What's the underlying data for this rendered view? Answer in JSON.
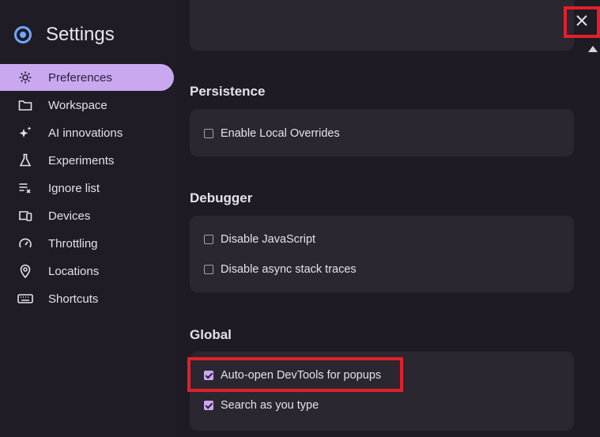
{
  "header": {
    "title": "Settings",
    "logo_icon": "settings-logo-icon"
  },
  "sidebar": {
    "items": [
      {
        "label": "Preferences",
        "icon": "gear-icon",
        "active": true
      },
      {
        "label": "Workspace",
        "icon": "folder-icon"
      },
      {
        "label": "AI innovations",
        "icon": "sparkle-icon"
      },
      {
        "label": "Experiments",
        "icon": "flask-icon"
      },
      {
        "label": "Ignore list",
        "icon": "list-x-icon"
      },
      {
        "label": "Devices",
        "icon": "devices-icon"
      },
      {
        "label": "Throttling",
        "icon": "gauge-icon"
      },
      {
        "label": "Locations",
        "icon": "pin-icon"
      },
      {
        "label": "Shortcuts",
        "icon": "keyboard-icon"
      }
    ]
  },
  "sections": {
    "persistence": {
      "title": "Persistence",
      "options": [
        {
          "label": "Enable Local Overrides",
          "checked": false
        }
      ]
    },
    "debugger": {
      "title": "Debugger",
      "options": [
        {
          "label": "Disable JavaScript",
          "checked": false
        },
        {
          "label": "Disable async stack traces",
          "checked": false
        }
      ]
    },
    "global": {
      "title": "Global",
      "options": [
        {
          "label": "Auto-open DevTools for popups",
          "checked": true
        },
        {
          "label": "Search as you type",
          "checked": true
        }
      ]
    }
  },
  "colors": {
    "accent": "#c9a8f0",
    "highlight": "#e0202a",
    "background": "#1e1b24",
    "card": "#2b2730"
  },
  "close_button": {
    "icon": "close-icon"
  }
}
